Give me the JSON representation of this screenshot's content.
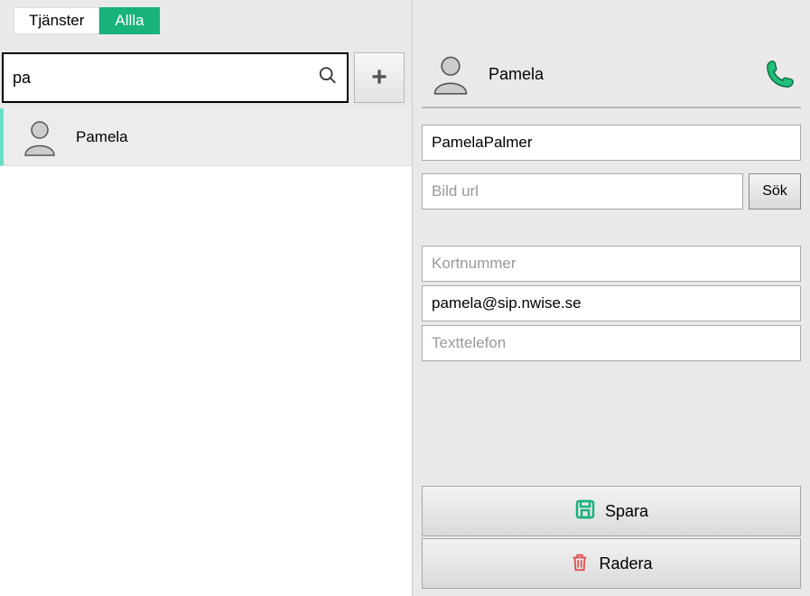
{
  "tabs": {
    "services": "Tjänster",
    "all": "Allla"
  },
  "search": {
    "value": "pa"
  },
  "contacts": [
    {
      "name": "Pamela"
    }
  ],
  "detail": {
    "title": "Pamela",
    "name_value": "PamelaPalmer",
    "image_url_placeholder": "Bild url",
    "search_btn": "Sök",
    "short_number_placeholder": "Kortnummer",
    "sip_value": "pamela@sip.nwise.se",
    "text_phone_placeholder": "Texttelefon",
    "save_label": "Spara",
    "delete_label": "Radera"
  },
  "colors": {
    "accent_green": "#17b37a",
    "danger_red": "#e05050"
  }
}
